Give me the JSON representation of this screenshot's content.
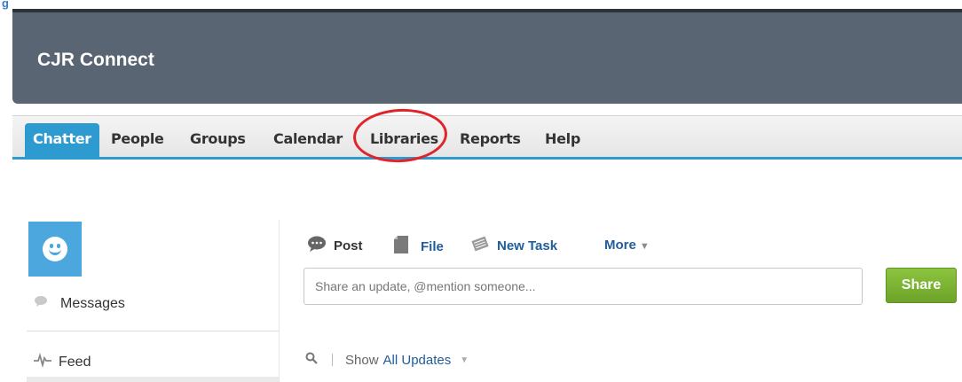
{
  "corner_label": "g",
  "header": {
    "title": "CJR Connect"
  },
  "tabs": [
    {
      "label": "Chatter",
      "active": true
    },
    {
      "label": "People",
      "active": false
    },
    {
      "label": "Groups",
      "active": false
    },
    {
      "label": "Calendar",
      "active": false
    },
    {
      "label": "Libraries",
      "active": false,
      "circled": true
    },
    {
      "label": "Reports",
      "active": false
    },
    {
      "label": "Help",
      "active": false
    }
  ],
  "sidebar": {
    "avatar_icon": "smiley-face-icon",
    "items": [
      {
        "label": "Messages",
        "icon": "speech-bubble-icon"
      },
      {
        "label": "Feed",
        "icon": "pulse-line-icon"
      }
    ]
  },
  "publisher": {
    "actions": [
      {
        "label": "Post",
        "icon": "chat-bubble-icon"
      },
      {
        "label": "File",
        "icon": "document-icon"
      },
      {
        "label": "New Task",
        "icon": "notepad-icon"
      }
    ],
    "more_label": "More",
    "input_placeholder": "Share an update, @mention someone...",
    "share_label": "Share"
  },
  "feed_filter": {
    "show_label": "Show",
    "value": "All Updates"
  },
  "colors": {
    "header_bg": "#596573",
    "tab_accent": "#2d9bd0",
    "link_blue": "#1f5d9b",
    "share_green": "#7bb534",
    "highlight_red": "#e0242a"
  }
}
